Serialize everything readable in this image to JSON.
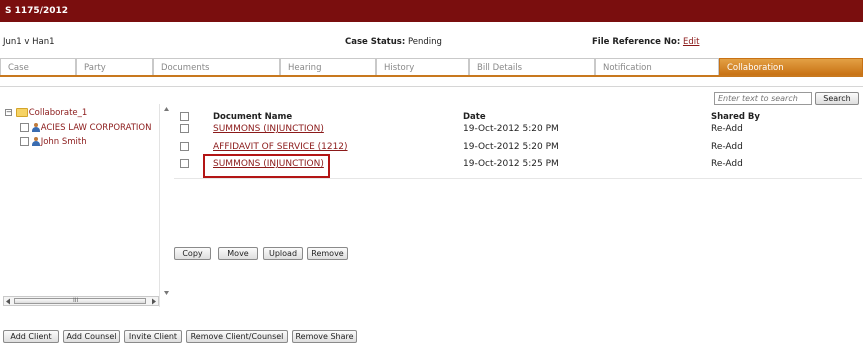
{
  "header": {
    "title": "S 1175/2012"
  },
  "info": {
    "parties": "Jun1 v Han1",
    "status_label": "Case Status:",
    "status_value": "Pending",
    "fileref_label": "File Reference No:",
    "fileref_link": "Edit"
  },
  "tabs": [
    {
      "label": "Case",
      "active": false
    },
    {
      "label": "Party",
      "active": false
    },
    {
      "label": "Documents",
      "active": false
    },
    {
      "label": "Hearing",
      "active": false
    },
    {
      "label": "History",
      "active": false
    },
    {
      "label": "Bill Details",
      "active": false
    },
    {
      "label": "Notification",
      "active": false
    },
    {
      "label": "Collaboration",
      "active": true
    }
  ],
  "search": {
    "placeholder": "Enter text to search",
    "button": "Search"
  },
  "tree": {
    "root": {
      "toggle": "−",
      "label": "Collaborate_1"
    },
    "children": [
      {
        "label": "ACIES LAW CORPORATION"
      },
      {
        "label": "John Smith"
      }
    ],
    "hscroll_grip": "III"
  },
  "table": {
    "columns": [
      "Document Name",
      "Date",
      "Shared By"
    ],
    "rows": [
      {
        "name": "SUMMONS (INJUNCTION)",
        "date": "19-Oct-2012 5:20 PM",
        "shared_by": "Re-Add"
      },
      {
        "name": "AFFIDAVIT OF SERVICE (1212)",
        "date": "19-Oct-2012 5:20 PM",
        "shared_by": "Re-Add"
      },
      {
        "name": "SUMMONS (INJUNCTION)",
        "date": "19-Oct-2012 5:25 PM",
        "shared_by": "Re-Add"
      }
    ]
  },
  "doc_actions": [
    "Copy",
    "Move",
    "Upload",
    "Remove"
  ],
  "bottom_actions": [
    "Add Client",
    "Add Counsel",
    "Invite Client",
    "Remove Client/Counsel",
    "Remove Share"
  ],
  "colors": {
    "titlebar": "#7a0e0e",
    "active_tab": "#c87214",
    "link": "#8b1a1a",
    "highlight": "#b31515"
  }
}
